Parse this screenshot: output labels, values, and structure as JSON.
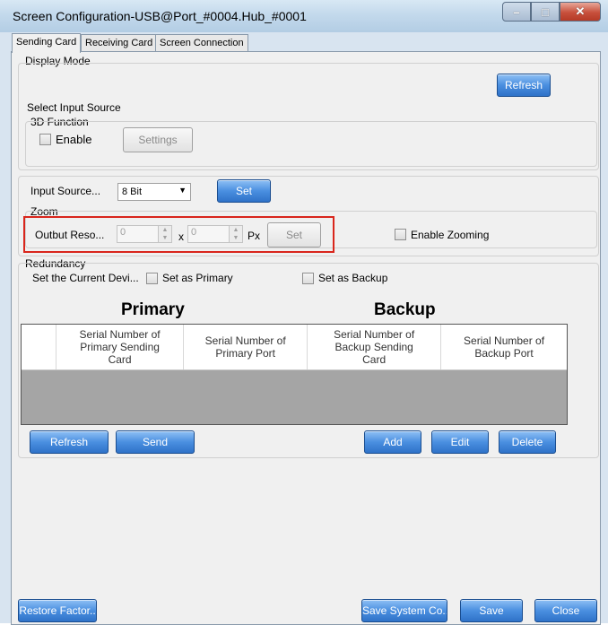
{
  "window": {
    "title": "Screen Configuration-USB@Port_#0004.Hub_#0001",
    "controls": {
      "minimize": "–",
      "maximize": "□",
      "close": "✕"
    }
  },
  "tabs": [
    {
      "label": "Sending Card",
      "active": true
    },
    {
      "label": "Receiving Card",
      "active": false
    },
    {
      "label": "Screen Connection",
      "active": false
    }
  ],
  "display_mode": {
    "label": "Display Mode",
    "refresh_label": "Refresh",
    "select_input_source": "Select Input Source",
    "function_3d": {
      "label": "3D Function",
      "enable_label": "Enable",
      "enable_checked": false,
      "settings_label": "Settings"
    }
  },
  "input_source": {
    "label": "Input Source...",
    "selected": "8 Bit",
    "set_label": "Set"
  },
  "zoom": {
    "label": "Zoom",
    "output_label": "Outbut Reso...",
    "width_value": "0",
    "times": "x",
    "height_value": "0",
    "unit": "Px",
    "set_label": "Set",
    "enable_zooming_label": "Enable Zooming",
    "enable_zooming_checked": false
  },
  "redundancy": {
    "label": "Redundancy",
    "current_device_label": "Set the Current Devi...",
    "primary_checkbox_label": "Set as Primary",
    "backup_checkbox_label": "Set as Backup",
    "primary_heading": "Primary",
    "backup_heading": "Backup",
    "columns": [
      "",
      "Serial Number of Primary Sending Card",
      "Serial Number of Primary Port",
      "Serial Number of Backup Sending Card",
      "Serial Number of Backup Port"
    ],
    "buttons": {
      "refresh": "Refresh",
      "send": "Send",
      "add": "Add",
      "edit": "Edit",
      "delete": "Delete"
    }
  },
  "footer": {
    "restore_label": "Restore Factor..",
    "save_system_label": "Save System Co...",
    "save_label": "Save",
    "close_label": "Close"
  },
  "colors": {
    "button_blue": "#4a8fe0",
    "highlight_red": "#d9261c",
    "table_empty_area": "#a5a5a5"
  }
}
